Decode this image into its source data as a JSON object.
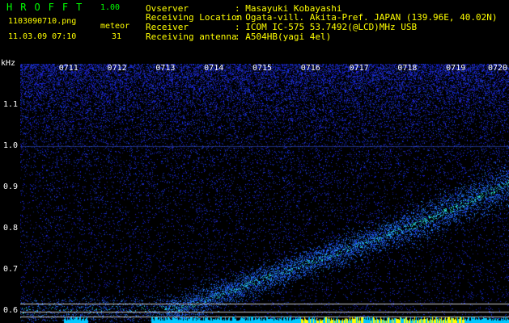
{
  "header": {
    "app_title": "HROFFT",
    "app_version": "1.00",
    "file_name": "1103090710.png",
    "datetime": "11.03.09 07:10",
    "meteor_label": "meteor",
    "meteor_count": "31"
  },
  "station": {
    "rows": [
      {
        "label": "Ovserver",
        "value": ": Masayuki Kobayashi"
      },
      {
        "label": "Receiving Location",
        "value": ": Ogata-vill. Akita-Pref. JAPAN (139.96E, 40.02N)"
      },
      {
        "label": "Receiver",
        "value": ": ICOM IC-575 53.7492(@LCD)MHz USB"
      },
      {
        "label": "Receiving antenna",
        "value": ": A504HB(yagi 4el)"
      }
    ]
  },
  "spectrogram": {
    "freq_unit": "kHz",
    "y_ticks": [
      "1.1",
      "1.0",
      "0.9",
      "0.8",
      "0.7",
      "0.6"
    ],
    "y_tick_values": [
      1.1,
      1.0,
      0.9,
      0.8,
      0.7,
      0.6
    ],
    "freq_range": [
      0.57,
      1.2
    ],
    "x_ticks": [
      "0711",
      "0712",
      "0713",
      "0714",
      "0715",
      "0716",
      "0717",
      "0718",
      "0719",
      "0720"
    ],
    "x_tick_minutes": [
      1,
      2,
      3,
      4,
      5,
      6,
      7,
      8,
      9,
      10
    ],
    "time_range_minutes": [
      0,
      10.1
    ],
    "colors": {
      "background": "#000000",
      "noise": "#1a28c8",
      "signal_mid": "#00c8ff",
      "signal_hot": "#ffff00",
      "text_green": "#00ff00",
      "text_yellow": "#ffff00",
      "text_white": "#ffffff",
      "guide_lines": "#c8c8c8"
    }
  }
}
